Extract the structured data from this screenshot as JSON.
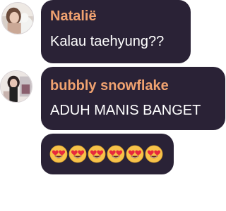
{
  "messages": [
    {
      "sender": "Natalië",
      "text": "Kalau taehyung??",
      "avatar_icon": "user-avatar-photo"
    },
    {
      "sender": "bubbly snowflake",
      "text": "ADUH MANIS BANGET",
      "avatar_icon": "user-avatar-photo"
    },
    {
      "emoji_icon": "heart-eyes-emoji",
      "emoji_count": 6
    }
  ],
  "colors": {
    "bubble_background": "#2a2236",
    "sender_name": "#f0a270",
    "message_text": "#ffffff",
    "page_background": "#ffffff"
  }
}
